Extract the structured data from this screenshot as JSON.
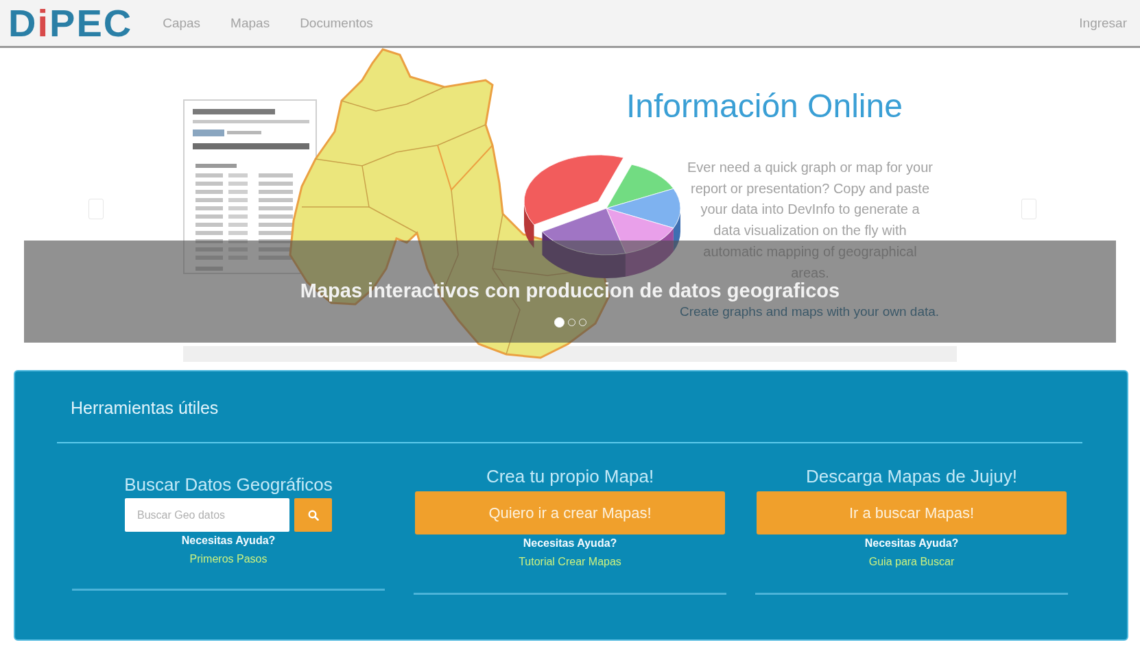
{
  "header": {
    "logo": "DiPEC",
    "nav": [
      "Capas",
      "Mapas",
      "Documentos"
    ],
    "login": "Ingresar"
  },
  "carousel": {
    "slide": {
      "title": "Información Online",
      "description": "Ever need a quick graph or map for your report or presentation? Copy and paste your data into DevInfo to generate a data visualization on the fly with automatic mapping of geographical areas.",
      "link": "Create graphs and maps with your own data."
    },
    "caption": "Mapas interactivos con produccion de datos geograficos",
    "indicators": [
      {
        "selected": true
      },
      {
        "selected": false
      },
      {
        "selected": false
      }
    ]
  },
  "tools": {
    "title": "Herramientas útiles",
    "cards": [
      {
        "kind": "search",
        "heading": "Buscar Datos Geográficos",
        "placeholder": "Buscar Geo datos",
        "help": "Necesitas Ayuda?",
        "link": "Primeros Pasos"
      },
      {
        "kind": "button",
        "heading": "Crea tu propio Mapa!",
        "button": "Quiero ir a crear Mapas!",
        "help": "Necesitas Ayuda?",
        "link": "Tutorial Crear Mapas"
      },
      {
        "kind": "button",
        "heading": "Descarga Mapas de Jujuy!",
        "button": "Ir a buscar Mapas!",
        "help": "Necesitas Ayuda?",
        "link": "Guia para Buscar"
      }
    ]
  }
}
